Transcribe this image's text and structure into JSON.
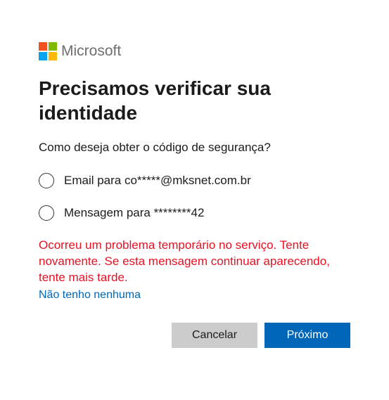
{
  "brand": {
    "name": "Microsoft"
  },
  "title": "Precisamos verificar sua identidade",
  "subtitle": "Como deseja obter o código de segurança?",
  "options": [
    {
      "label": "Email para co*****@mksnet.com.br"
    },
    {
      "label": "Mensagem para ********42"
    }
  ],
  "error": "Ocorreu um problema temporário no serviço. Tente novamente. Se esta mensagem continuar aparecendo, tente mais tarde.",
  "none_link": "Não tenho nenhuma",
  "buttons": {
    "cancel": "Cancelar",
    "next": "Próximo"
  }
}
